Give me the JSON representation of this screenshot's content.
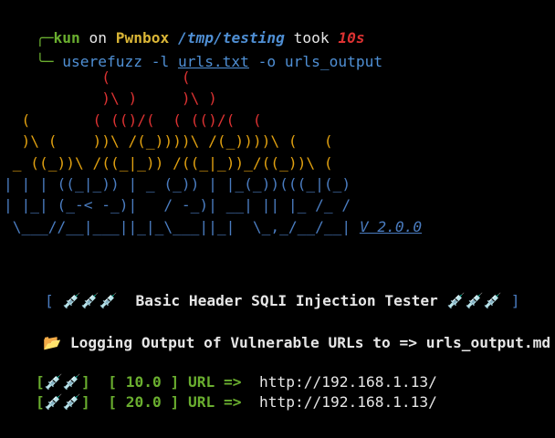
{
  "prompt": {
    "user": "kun",
    "on": "on",
    "host": "Pwnbox",
    "path": "/tmp/testing",
    "took": "took",
    "duration": "10s",
    "arrow_top": "╭─",
    "arrow_bottom": "╰─"
  },
  "command": {
    "program": "userefuzz",
    "flag_l": "-l",
    "file": "urls.txt",
    "flag_o": "-o",
    "output": "urls_output"
  },
  "banner": {
    "line1_red": "           (        (",
    "line2_red": "           )\\ )     )\\ )",
    "line3a": "  (       ",
    "line3b": "( (()/(  ( (()/(  (",
    "line4a": "  )\\ (    ))\\ /(_))))\\ /(_))))\\ (   (",
    "line5a": " _ ((_))\\ /((_|_)) /((_|_))_/((_))\\ (",
    "line6": "| | | ((_|_)) | _ (_)) | |_(_))(((_|(_)",
    "line7": "| |_| (_-< -_)|   / -_)| __| || |_ /_ /",
    "line8": " \\___//__|___||_|_\\___||_|  \\_,_/__/__|",
    "version": "V 2.0.0"
  },
  "header": {
    "open": "[",
    "emoji_left": "💉💉💉",
    "title": "Basic Header SQLI Injection Tester",
    "emoji_right": "💉💉💉",
    "close": "]"
  },
  "logging": {
    "icon": "📂",
    "text": "Logging Output of Vulnerable URLs to => urls_output.md"
  },
  "results": [
    {
      "tag": "[💉💉]",
      "time": "[ 10.0 ]",
      "label": "URL =>",
      "url": "http://192.168.1.13/"
    },
    {
      "tag": "[💉💉]",
      "time": "[ 20.0 ]",
      "label": "URL =>",
      "url": "http://192.168.1.13/"
    }
  ]
}
